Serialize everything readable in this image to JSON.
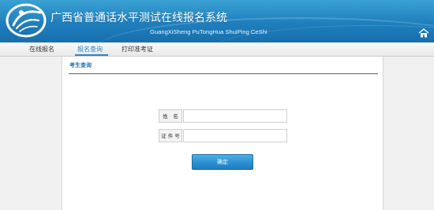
{
  "header": {
    "title": "广西省普通话水平测试在线报名系统",
    "subtitle": "GuangXiSheng PuTongHua ShuiPing CeShi",
    "colors": {
      "header_top": "#3aa1d3",
      "header_bottom": "#176fad",
      "accent": "#2b87c9"
    }
  },
  "nav": {
    "items": [
      {
        "label": "在线报名",
        "active": false
      },
      {
        "label": "报名查询",
        "active": true
      },
      {
        "label": "打印准考证",
        "active": false
      }
    ]
  },
  "panel": {
    "title": "考生查询",
    "form": {
      "name_label": "姓　名",
      "name_value": "",
      "id_label": "证 件 号",
      "id_value": "",
      "submit_label": "确定"
    }
  },
  "icons": {
    "logo": "logo-emblem-icon",
    "home": "home-icon"
  }
}
